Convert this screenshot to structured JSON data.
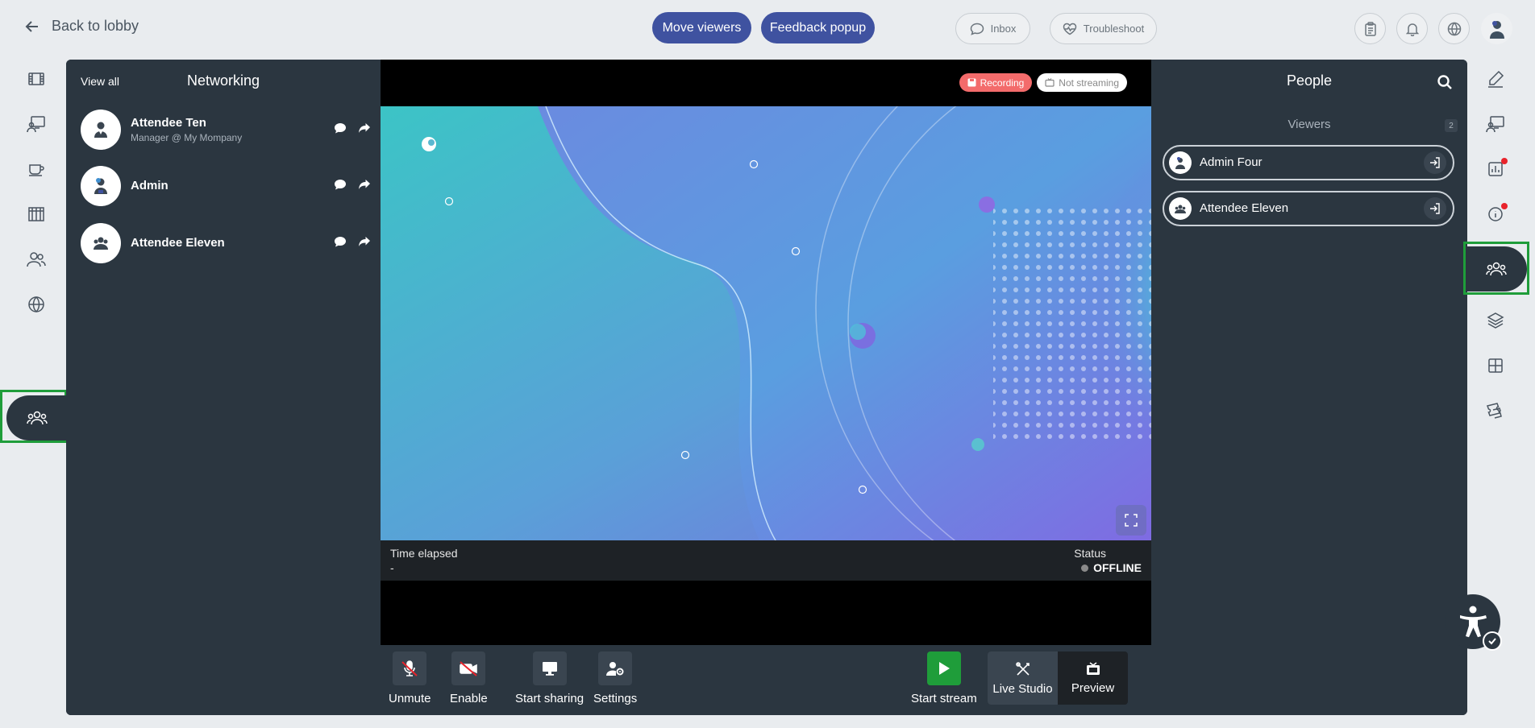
{
  "header": {
    "back_label": "Back to lobby",
    "move_viewers": "Move viewers",
    "feedback_popup": "Feedback popup",
    "inbox": "Inbox",
    "troubleshoot": "Troubleshoot"
  },
  "networking": {
    "view_all": "View all",
    "title": "Networking",
    "attendees": [
      {
        "name": "Attendee Ten",
        "subtitle": "Manager @ My Mompany"
      },
      {
        "name": "Admin",
        "subtitle": ""
      },
      {
        "name": "Attendee Eleven",
        "subtitle": ""
      }
    ]
  },
  "stage": {
    "recording": "Recording",
    "not_streaming": "Not streaming",
    "time_elapsed_label": "Time elapsed",
    "time_elapsed_value": "-",
    "status_label": "Status",
    "status_value": "OFFLINE"
  },
  "controls": {
    "unmute": "Unmute",
    "enable": "Enable",
    "start_sharing": "Start sharing",
    "settings": "Settings",
    "start_stream": "Start stream",
    "live_studio": "Live Studio",
    "preview": "Preview"
  },
  "people": {
    "title": "People",
    "viewers_label": "Viewers",
    "viewers_count": "2",
    "viewers": [
      {
        "name": "Admin Four"
      },
      {
        "name": "Attendee Eleven"
      }
    ]
  },
  "colors": {
    "accent": "#3f52a0",
    "panel": "#2b3640",
    "active_outline": "#1f9d3a",
    "recording": "#f36b6b",
    "notification": "#e8232b"
  },
  "icons": {
    "left_rail": [
      "film-icon",
      "presentation-icon",
      "coffee-icon",
      "booth-icon",
      "users-icon",
      "globe-icon",
      "people-group-icon"
    ],
    "right_rail": [
      "edit-icon",
      "presentation-icon",
      "poll-chart-icon",
      "info-icon",
      "people-group-icon",
      "layers-icon",
      "grid-icon",
      "tickets-icon"
    ]
  }
}
